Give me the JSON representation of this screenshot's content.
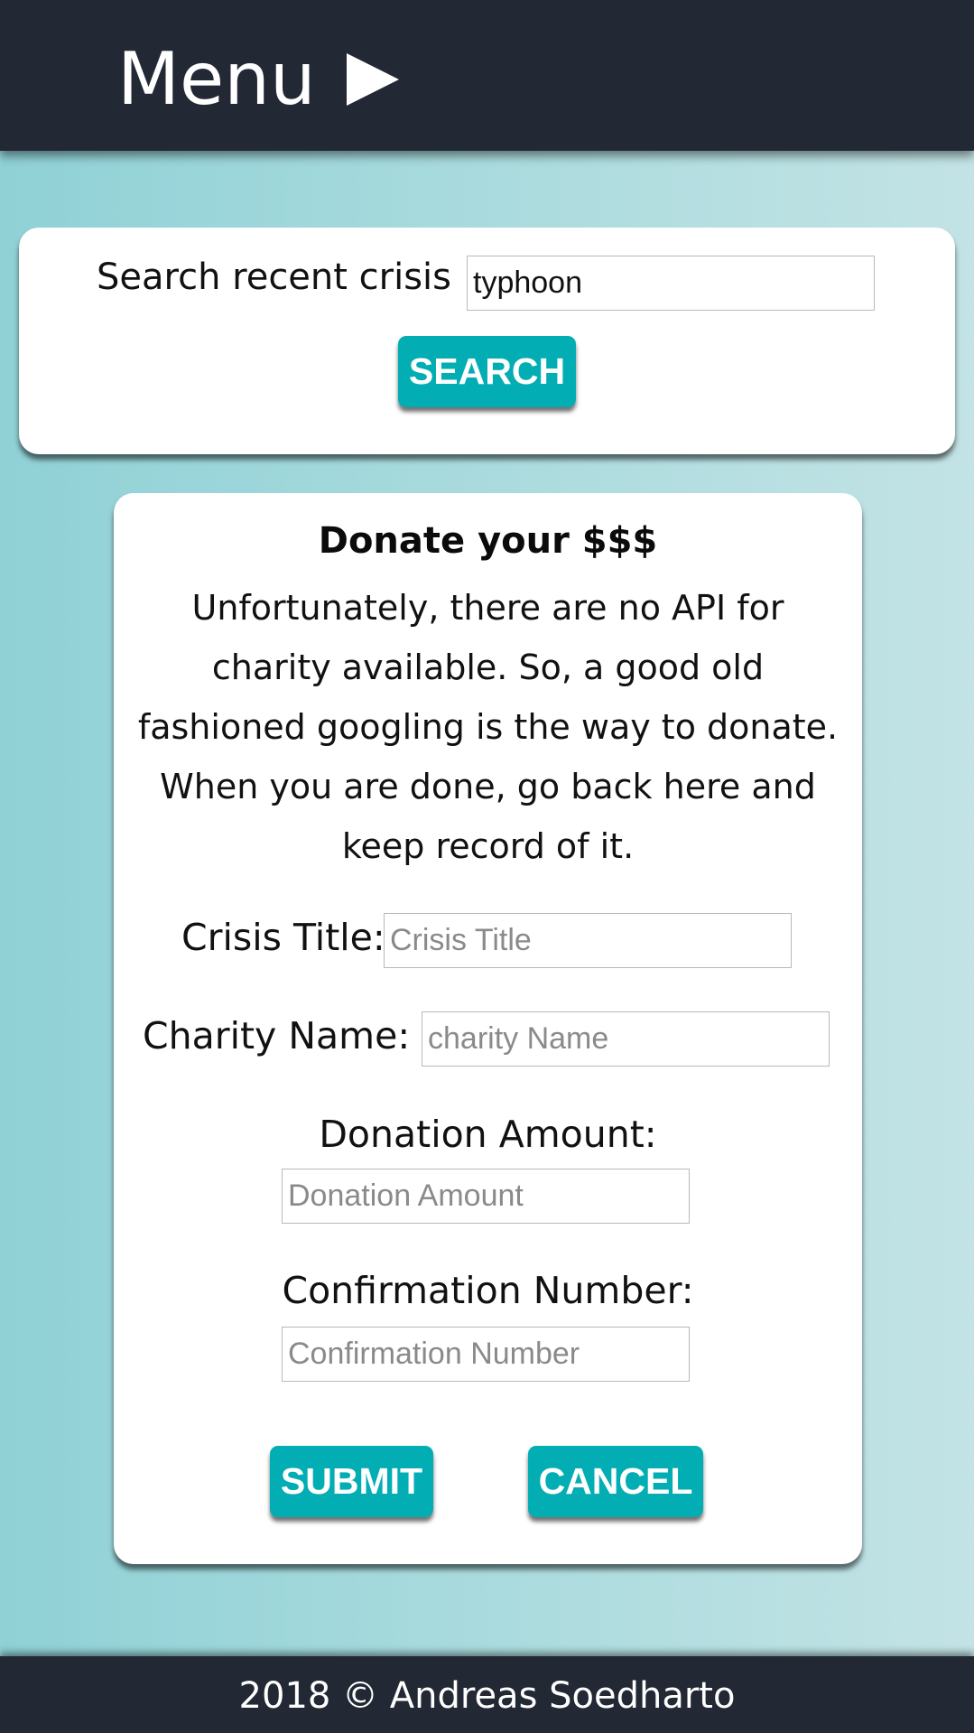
{
  "header": {
    "menu_label": "Menu",
    "menu_icon": "triangle-right-icon"
  },
  "search": {
    "label": "Search recent crisis",
    "input_value": "typhoon",
    "button_label": "SEARCH"
  },
  "donate": {
    "heading": "Donate your $$$",
    "description": "Unfortunately, there are no API for charity available. So, a good old fashioned googling is the way to donate. When you are done, go back here and keep record of it.",
    "crisis_title_label": "Crisis Title:",
    "crisis_title_placeholder": "Crisis Title",
    "charity_name_label": "Charity Name:",
    "charity_name_placeholder": "charity Name",
    "donation_amount_label": "Donation Amount:",
    "donation_amount_placeholder": "Donation Amount",
    "confirmation_number_label": "Confirmation Number:",
    "confirmation_number_placeholder": "Confirmation Number",
    "submit_label": "SUBMIT",
    "cancel_label": "CANCEL"
  },
  "footer": {
    "text": "2018 © Andreas Soedharto"
  },
  "colors": {
    "navbar": "#222834",
    "accent": "#02aeb3",
    "background_gradient": [
      "#8fd1d6",
      "#c3e3e5"
    ],
    "card": "#ffffff"
  }
}
